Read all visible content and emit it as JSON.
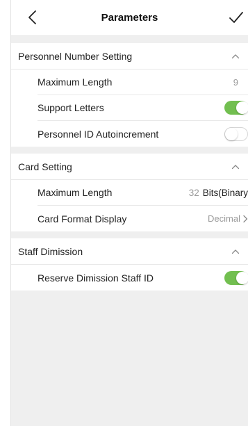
{
  "header": {
    "title": "Parameters",
    "back_icon": "chevron-left-icon",
    "done_icon": "checkmark-icon"
  },
  "colors": {
    "toggle_on": "#72bf50",
    "background": "#efefef"
  },
  "sections": [
    {
      "title": "Personnel Number Setting",
      "rows": [
        {
          "label": "Maximum Length",
          "value": "9"
        },
        {
          "label": "Support Letters",
          "toggle": true
        },
        {
          "label": "Personnel ID Autoincrement",
          "toggle": false
        }
      ]
    },
    {
      "title": "Card Setting",
      "rows": [
        {
          "label": "Maximum Length",
          "value_number": "32",
          "value_unit": "Bits(Binary"
        },
        {
          "label": "Card Format Display",
          "value": "Decimal"
        }
      ]
    },
    {
      "title": "Staff Dimission",
      "rows": [
        {
          "label": "Reserve Dimission Staff ID",
          "toggle": true
        }
      ]
    }
  ]
}
